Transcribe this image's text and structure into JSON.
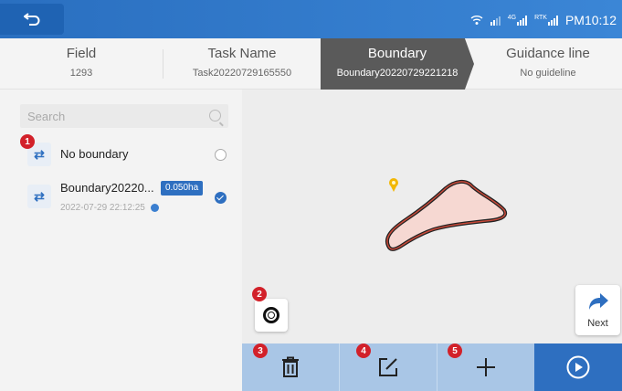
{
  "status_bar": {
    "time": "PM10:12",
    "rtk_label": "RTK",
    "signal_label": "4G"
  },
  "steps": [
    {
      "title": "Field",
      "value": "1293"
    },
    {
      "title": "Task Name",
      "value": "Task20220729165550"
    },
    {
      "title": "Boundary",
      "value": "Boundary20220729221218"
    },
    {
      "title": "Guidance line",
      "value": "No guideline"
    }
  ],
  "left_panel": {
    "search_placeholder": "Search",
    "items": [
      {
        "label": "No boundary",
        "selected": false
      },
      {
        "label": "Boundary20220...",
        "area": "0.050ha",
        "date": "2022-07-29 22:12:25",
        "selected": true
      }
    ]
  },
  "markers": [
    "1",
    "2",
    "3",
    "4",
    "5"
  ],
  "map": {
    "next_label": "Next",
    "boundary_color": "#c94a3a",
    "pin_color": "#f2b705"
  },
  "toolbar": {
    "icons": [
      "trash-icon",
      "edit-icon",
      "plus-icon",
      "play-icon"
    ]
  },
  "colors": {
    "accent": "#2e6fc0",
    "toolbar": "#a9c6e6",
    "active_step": "#5a5a5a"
  }
}
